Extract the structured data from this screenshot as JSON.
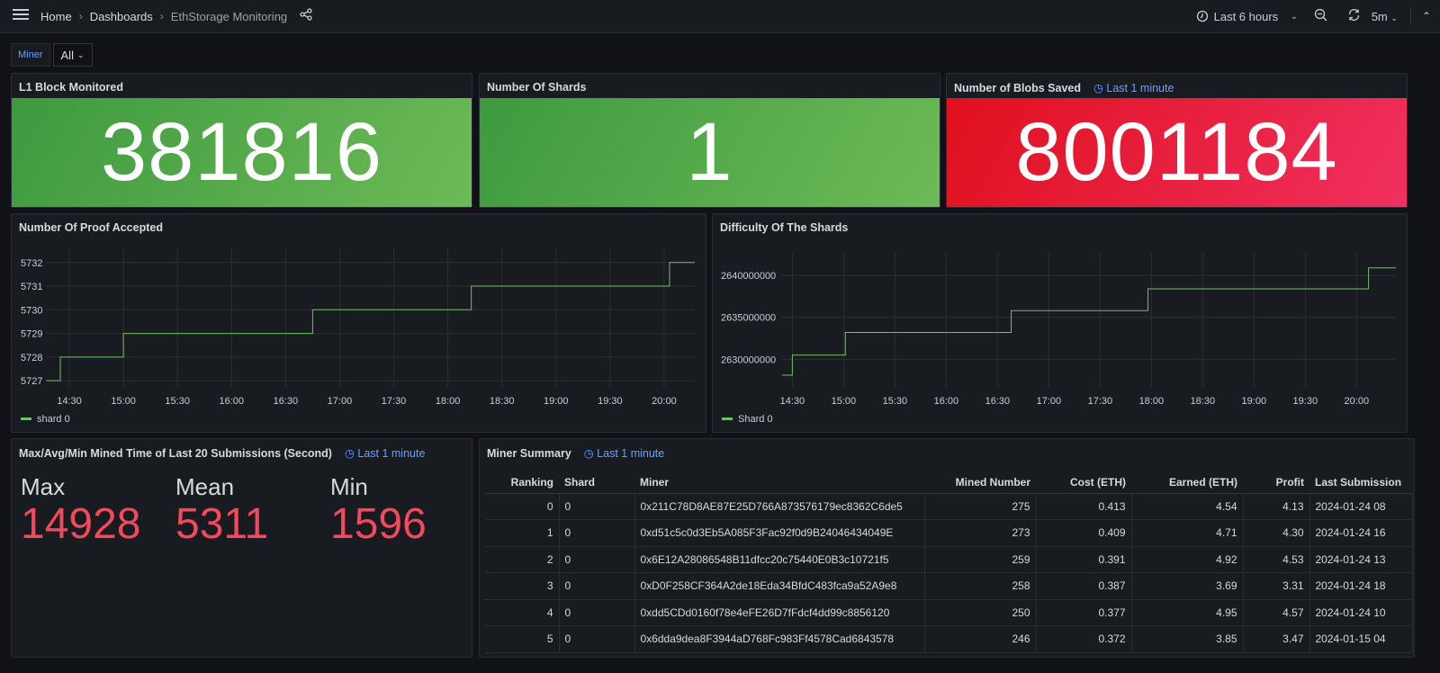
{
  "topbar": {
    "breadcrumb": [
      "Home",
      "Dashboards",
      "EthStorage Monitoring"
    ],
    "time_range": "Last 6 hours",
    "refresh": "5m"
  },
  "variables": {
    "label": "Miner",
    "value": "All"
  },
  "panels": {
    "l1": {
      "title": "L1 Block Monitored",
      "value": "381816",
      "color": "#56a64b"
    },
    "shards": {
      "title": "Number Of Shards",
      "value": "1",
      "color": "#56a64b"
    },
    "blobs": {
      "title": "Number of Blobs Saved",
      "time": "Last 1 minute",
      "value": "8001184",
      "color": "#e02f44"
    },
    "mined": {
      "title": "Max/Avg/Min Mined Time of Last 20 Submissions (Second)",
      "time": "Last 1 minute",
      "stats": [
        {
          "label": "Max",
          "value": "14928"
        },
        {
          "label": "Mean",
          "value": "5311"
        },
        {
          "label": "Min",
          "value": "1596"
        }
      ],
      "color": "#f2495c"
    },
    "summary": {
      "title": "Miner Summary",
      "time": "Last 1 minute",
      "columns": [
        "Ranking",
        "Shard",
        "Miner",
        "Mined Number",
        "Cost (ETH)",
        "Earned (ETH)",
        "Profit",
        "Last Submission"
      ],
      "rows": [
        [
          "0",
          "0",
          "0x211C78D8AE87E25D766A873576179ec8362C6de5",
          "275",
          "0.413",
          "4.54",
          "4.13",
          "2024-01-24 08"
        ],
        [
          "1",
          "0",
          "0xd51c5c0d3Eb5A085F3Fac92f0d9B24046434049E",
          "273",
          "0.409",
          "4.71",
          "4.30",
          "2024-01-24 16"
        ],
        [
          "2",
          "0",
          "0x6E12A28086548B11dfcc20c75440E0B3c10721f5",
          "259",
          "0.391",
          "4.92",
          "4.53",
          "2024-01-24 13"
        ],
        [
          "3",
          "0",
          "0xD0F258CF364A2de18Eda34BfdC483fca9a52A9e8",
          "258",
          "0.387",
          "3.69",
          "3.31",
          "2024-01-24 18"
        ],
        [
          "4",
          "0",
          "0xdd5CDd0160f78e4eFE26D7fFdcf4dd99c8856120",
          "250",
          "0.377",
          "4.95",
          "4.57",
          "2024-01-24 10"
        ],
        [
          "5",
          "0",
          "0x6dda9dea8F3944aD768Fc983Ff4578Cad6843578",
          "246",
          "0.372",
          "3.85",
          "3.47",
          "2024-01-15 04"
        ]
      ]
    }
  },
  "chart_data": [
    {
      "type": "line",
      "title": "Number Of Proof Accepted",
      "step": true,
      "color": "#73bf69",
      "grid": true,
      "legend_placement": "bottom-left",
      "xticks": [
        "14:30",
        "15:00",
        "15:30",
        "16:00",
        "16:30",
        "17:00",
        "17:30",
        "18:00",
        "18:30",
        "19:00",
        "19:30",
        "20:00"
      ],
      "yticks": [
        5727,
        5728,
        5729,
        5730,
        5731,
        5732
      ],
      "xlim": [
        "14:17",
        "20:17"
      ],
      "ylim": [
        5726.7,
        5732.6
      ],
      "series": [
        {
          "name": "shard 0",
          "x": [
            "14:17",
            "14:25",
            "15:00",
            "16:45",
            "18:13",
            "20:03",
            "20:17"
          ],
          "y": [
            5727,
            5728,
            5729,
            5730,
            5731,
            5732,
            5732
          ]
        }
      ]
    },
    {
      "type": "line",
      "title": "Difficulty Of The Shards",
      "step": true,
      "color": "#73bf69",
      "grid": true,
      "legend_placement": "bottom-left",
      "xticks": [
        "14:30",
        "15:00",
        "15:30",
        "16:00",
        "16:30",
        "17:00",
        "17:30",
        "18:00",
        "18:30",
        "19:00",
        "19:30",
        "20:00"
      ],
      "yticks": [
        2630000000,
        2635000000,
        2640000000
      ],
      "xlim": [
        "14:24",
        "20:23"
      ],
      "ylim": [
        2626600000,
        2642700000
      ],
      "series": [
        {
          "name": "Shard 0",
          "x": [
            "14:24",
            "14:30",
            "15:01",
            "16:38",
            "17:58",
            "20:07",
            "20:23"
          ],
          "y": [
            2628100000,
            2630500000,
            2633200000,
            2635800000,
            2638400000,
            2640900000,
            2640900000
          ]
        }
      ]
    }
  ]
}
